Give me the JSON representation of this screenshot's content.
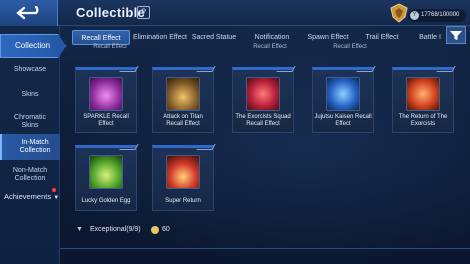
{
  "header": {
    "title": "Collectible",
    "help_icon": "?",
    "currency": {
      "icon": "Y",
      "value": "17768/100000"
    }
  },
  "sidebar": {
    "main": "Collection",
    "items": [
      {
        "label": "Showcase"
      },
      {
        "label": "Skins"
      },
      {
        "label": "Chromatic Skins"
      },
      {
        "label": "In-Match Collection"
      },
      {
        "label": "Non-Match Collection"
      }
    ],
    "achievements": "Achievements"
  },
  "tabs": [
    {
      "label": "Recall Effect"
    },
    {
      "label": "Elimination Effect"
    },
    {
      "label": "Sacred Statue"
    },
    {
      "label": "Notification"
    },
    {
      "label": "Spawn Effect"
    },
    {
      "label": "Trail Effect"
    },
    {
      "label": "Battle I"
    }
  ],
  "prev_row_labels": [
    "Recall Effect",
    "Recall Effect",
    "Recall Effect"
  ],
  "cards": [
    {
      "label": "SPARKLE Recall Effect",
      "color": "#c84cc8"
    },
    {
      "label": "Attack on Titan Recall Effect",
      "color": "#c69a4a"
    },
    {
      "label": "The Exorcists Squad Recall Effect",
      "color": "#d6364b"
    },
    {
      "label": "Jujutsu Kaisen Recall Effect",
      "color": "#2f7bd6"
    },
    {
      "label": "The Return of The Exorcists",
      "color": "#e2502a"
    },
    {
      "label": "Lucky Golden Egg",
      "color": "#5fbf38"
    },
    {
      "label": "Super Return",
      "color": "#d23a2a"
    }
  ],
  "footer": {
    "label": "Exceptional(9/9)",
    "points": "60"
  }
}
